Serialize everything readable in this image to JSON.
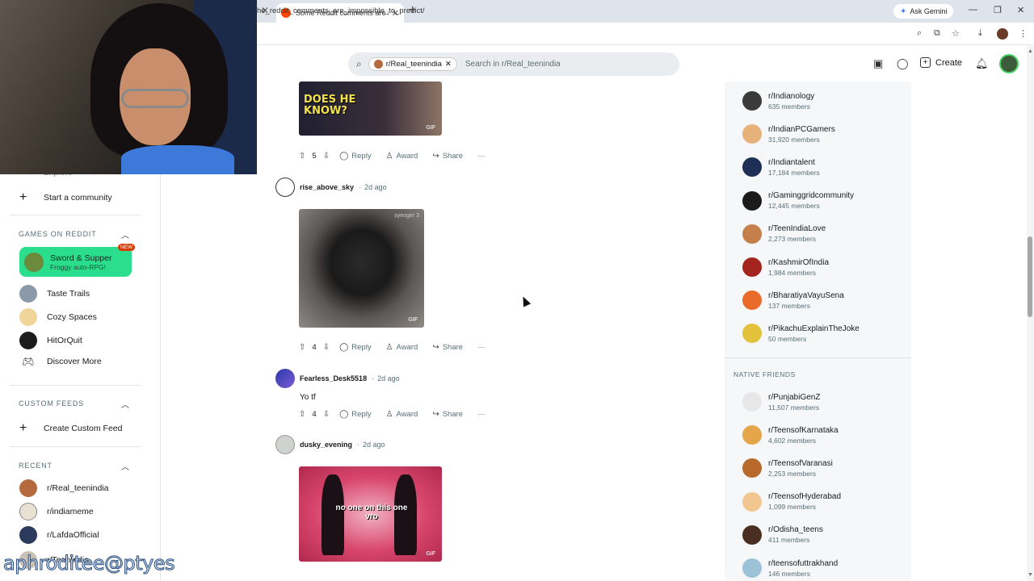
{
  "browser": {
    "tab_title": "Some Reddit comments are impossible to predict",
    "url": "he_reddit_comments_are_impossible_to_predict/",
    "ask_gemini": "Ask Gemini"
  },
  "header": {
    "search_chip": "r/Real_teenindia",
    "search_placeholder": "Search in r/Real_teenindia",
    "create_label": "Create"
  },
  "left_sidebar": {
    "explore_label": "Explore",
    "start_community": "Start a community",
    "games_section": "GAMES ON REDDIT",
    "featured_game": {
      "name": "Sword & Supper",
      "subtitle": "Froggy auto-RPG!",
      "badge": "NEW"
    },
    "games": [
      {
        "label": "Taste Trails",
        "color": "#8a9aa8"
      },
      {
        "label": "Cozy Spaces",
        "color": "#f0d49a"
      },
      {
        "label": "HitOrQuit",
        "color": "#1b1b1b"
      },
      {
        "label": "Discover More"
      }
    ],
    "custom_feeds_section": "CUSTOM FEEDS",
    "create_custom_feed": "Create Custom Feed",
    "recent_section": "RECENT",
    "recent": [
      {
        "label": "r/Real_teenindia",
        "color": "#b46a3c"
      },
      {
        "label": "r/indiameme",
        "color": "#e9e2d2"
      },
      {
        "label": "r/LafdaOfficial",
        "color": "#2c3a5e"
      },
      {
        "label": "r/TeenIndia",
        "color": "#c9c1b5"
      }
    ]
  },
  "watermark": "aphroditee@ptyes",
  "comments": [
    {
      "gif_caption": "DOES HE KNOW?",
      "gif_label": "GIF",
      "votes": "5",
      "reply": "Reply",
      "award": "Award",
      "share": "Share",
      "more": "···"
    },
    {
      "user": "rise_above_sky",
      "time": "2d ago",
      "gif_label": "GIF",
      "gif_watermark": "syeoger 3",
      "votes": "4",
      "reply": "Reply",
      "award": "Award",
      "share": "Share",
      "more": "···"
    },
    {
      "user": "Fearless_Desk5518",
      "time": "2d ago",
      "text": "Yo tf",
      "votes": "4",
      "reply": "Reply",
      "award": "Award",
      "share": "Share",
      "more": "···"
    },
    {
      "user": "dusky_evening",
      "time": "2d ago",
      "gif_caption": "no one on this one vro",
      "gif_label": "GIF"
    }
  ],
  "right_sidebar": {
    "communities": [
      {
        "name": "r/Indianology",
        "members": "635 members",
        "color": "#3a3a3a"
      },
      {
        "name": "r/IndianPCGamers",
        "members": "31,920 members",
        "color": "#e7b27a"
      },
      {
        "name": "r/Indiantalent",
        "members": "17,184 members",
        "color": "#1e2e55"
      },
      {
        "name": "r/Gaminggridcommunity",
        "members": "12,445 members",
        "color": "#1b1b1b"
      },
      {
        "name": "r/TeenIndiaLove",
        "members": "2,273 members",
        "color": "#c47f4b"
      },
      {
        "name": "r/KashmirOfIndia",
        "members": "1,984 members",
        "color": "#a4251f"
      },
      {
        "name": "r/BharatiyaVayuSena",
        "members": "137 members",
        "color": "#ea6a2a"
      },
      {
        "name": "r/PikachuExplainTheJoke",
        "members": "50 members",
        "color": "#e2c23a"
      }
    ],
    "native_friends_section": "NATIVE FRIENDS",
    "native_friends": [
      {
        "name": "r/PunjabiGenZ",
        "members": "11,507 members",
        "color": "#e7e7e7"
      },
      {
        "name": "r/TeensofKarnataka",
        "members": "4,602 members",
        "color": "#e5a64a"
      },
      {
        "name": "r/TeensofVaranasi",
        "members": "2,253 members",
        "color": "#b76a2c"
      },
      {
        "name": "r/TeensofHyderabad",
        "members": "1,099 members",
        "color": "#f2c690"
      },
      {
        "name": "r/Odisha_teens",
        "members": "411 members",
        "color": "#4a2e22"
      },
      {
        "name": "r/teensofuttrakhand",
        "members": "146 members",
        "color": "#9cc2d8"
      }
    ]
  }
}
